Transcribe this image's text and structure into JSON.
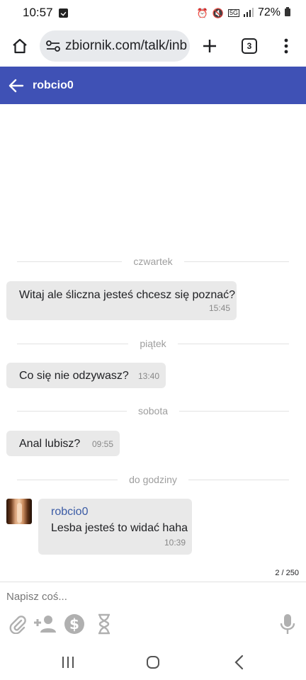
{
  "status_bar": {
    "time": "10:57",
    "battery": "72%",
    "network_label": "5G"
  },
  "browser": {
    "url": "zbiornik.com/talk/inb",
    "tab_count": "3"
  },
  "header": {
    "title": "robcio0"
  },
  "messages": [
    {
      "date": "czwartek",
      "text": "Witaj ale śliczna jesteś chcesz się poznać?",
      "time": "15:45"
    },
    {
      "date": "piątek",
      "text": "Co się nie odzywasz?",
      "time": "13:40"
    },
    {
      "date": "sobota",
      "text": "Anal lubisz?",
      "time": "09:55"
    },
    {
      "date": "do godziny",
      "sender": "robcio0",
      "text": "Lesba jesteś to widać haha",
      "time": "10:39"
    }
  ],
  "page_counter": "2 / 250",
  "composer": {
    "placeholder": "Napisz coś..."
  },
  "icons": {
    "home": "home-icon",
    "site_settings": "site-settings-icon",
    "new_tab": "plus-icon",
    "menu": "more-vert-icon",
    "back": "arrow-left-icon",
    "attach": "paperclip-icon",
    "add_person": "person-add-icon",
    "money": "dollar-icon",
    "timer": "hourglass-icon",
    "mic": "mic-icon"
  },
  "colors": {
    "header_bg": "#3f51b5",
    "bubble_bg": "#e9e9e9",
    "sender_name": "#3b5ba5",
    "tool_icon": "#b0b0b0"
  }
}
